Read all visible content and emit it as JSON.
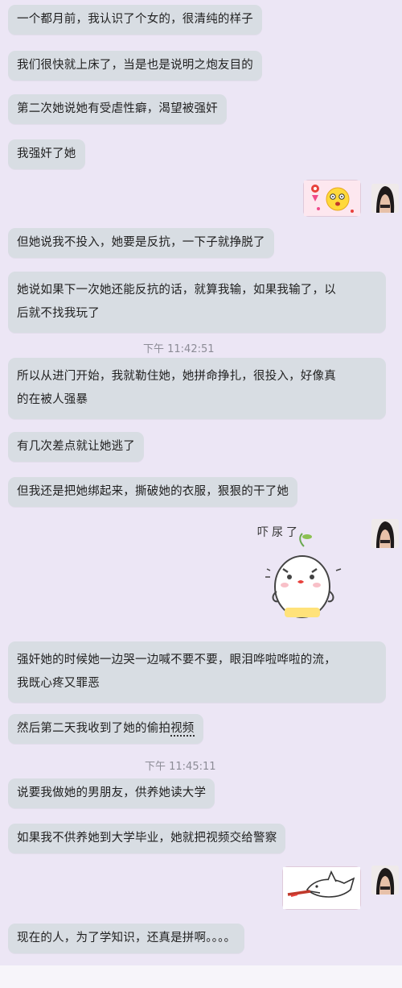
{
  "messages": [
    "一个都月前，我认识了个女的，很清纯的样子",
    "我们很快就上床了，当是也是说明之炮友目的",
    "第二次她说她有受虐性癖，渴望被强奸",
    "我强奸了她",
    "但她说我不投入，她要是反抗，一下子就挣脱了",
    "她说如果下一次她还能反抗的话，就算我输，如果我输了，以后就不找我玩了",
    "所以从进门开始，我就勒住她，她拼命挣扎，很投入，好像真的在被人强暴",
    "有几次差点就让她逃了",
    "但我还是把她绑起来，撕破她的衣服，狠狠的干了她",
    "强奸她的时候她一边哭一边喊不要不要，眼泪哗啦哗啦的流，我既心疼又罪恶",
    "然后第二天我收到了她的偷拍视频",
    "说要我做她的男朋友，供养她读大学",
    "如果我不供养她到大学毕业，她就把视频交给警察",
    "现在的人，为了学知识，还真是拼啊。。。。"
  ],
  "lines": {
    "m5a": "她说如果下一次她还能反抗的话，就算我输，如果我输了，以",
    "m5b": "后就不找我玩了",
    "m6a": "所以从进门开始，我就勒住她，她拼命挣扎，很投入，好像真",
    "m6b": "的在被人强暴",
    "m9a": "强奸她的时候她一边哭一边喊不要不要，眼泪哗啦哗啦的流，",
    "m9b": "我既心疼又罪恶",
    "m10a": "然后第二天我收到了她的偷拍",
    "m10b": "视频"
  },
  "timestamps": [
    "下午 11:42:51",
    "下午 11:45:11"
  ],
  "sticker_text": "吓尿了",
  "icons": {
    "sticker1": "surprised-face-sticker",
    "sticker2": "crying-bun-sticker",
    "sticker3": "shark-sticker",
    "avatar": "user-avatar-photo"
  },
  "colors": {
    "background": "#ece6f5",
    "bubble": "#d8dde3",
    "timestamp": "#8c8c96"
  }
}
